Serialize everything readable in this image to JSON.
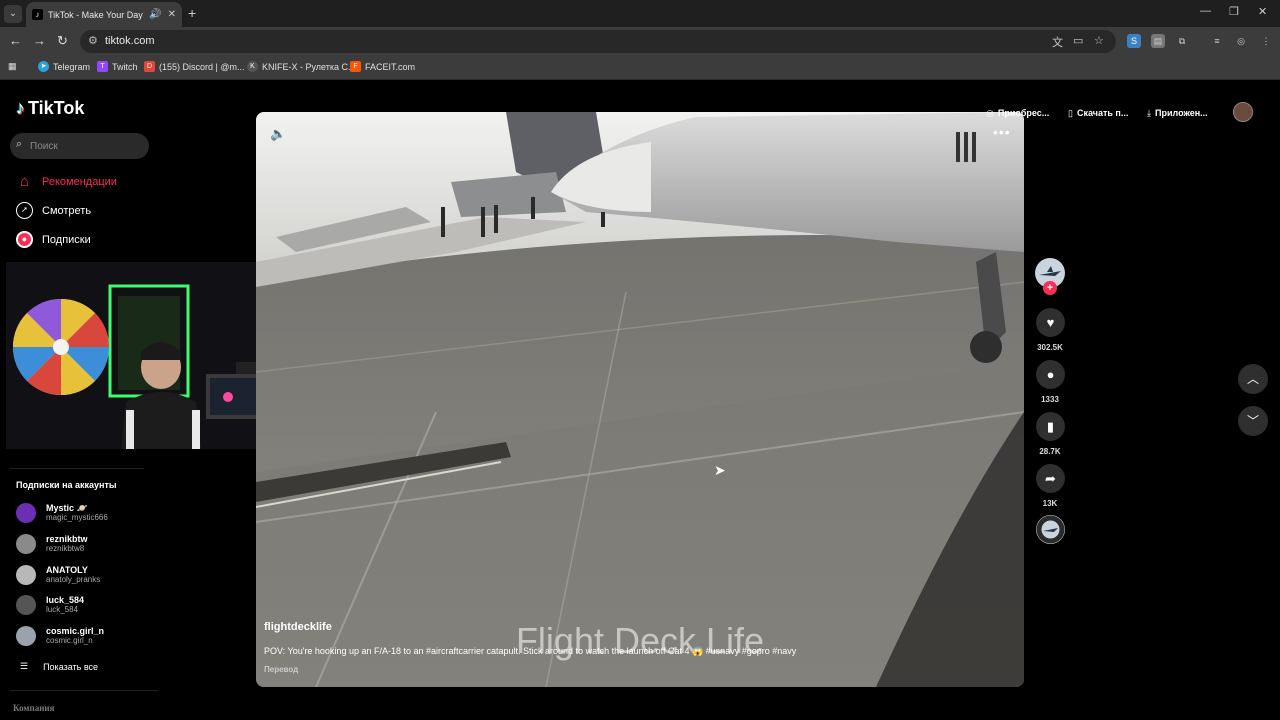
{
  "browser": {
    "tab_title": "TikTok - Make Your Day",
    "tab_favicon": "♪",
    "url": "tiktok.com",
    "bookmarks": [
      {
        "label": "Telegram",
        "color": "#2aa1da",
        "glyph": "➤"
      },
      {
        "label": "Twitch",
        "color": "#9147ff",
        "glyph": "T"
      },
      {
        "label": "(155) Discord | @m...",
        "color": "#e0463c",
        "glyph": "D"
      },
      {
        "label": "KNIFE-X - Рулетка С...",
        "color": "#555555",
        "glyph": "K"
      },
      {
        "label": "FACEIT.com",
        "color": "#ff5500",
        "glyph": "F"
      }
    ]
  },
  "sidebar": {
    "logo": "TikTok",
    "search_placeholder": "Поиск",
    "nav": [
      {
        "label": "Рекомендации",
        "icon": "home-icon"
      },
      {
        "label": "Смотреть",
        "icon": "compass-icon"
      },
      {
        "label": "Подписки",
        "icon": "following-icon"
      }
    ],
    "subs_title": "Подписки на аккаунты",
    "accounts": [
      {
        "name": "Mystic",
        "badge": "🪐",
        "handle": "magic_mystic666",
        "color": "#6b2fb3"
      },
      {
        "name": "reznikbtw",
        "badge": "",
        "handle": "reznikbtw8",
        "color": "#8a8a8a"
      },
      {
        "name": "ANATOLY",
        "badge": "",
        "handle": "anatoly_pranks",
        "color": "#b8b8b8"
      },
      {
        "name": "luck_584",
        "badge": "",
        "handle": "luck_584",
        "color": "#555555"
      },
      {
        "name": "cosmic.girl_n",
        "badge": "",
        "handle": "cosmic.girl_n",
        "color": "#9aa3ad"
      }
    ],
    "show_all": "Показать все",
    "company": "Компания"
  },
  "top_actions": [
    {
      "label": "Приобрес...",
      "icon": "coin-icon"
    },
    {
      "label": "Скачать п...",
      "icon": "phone-icon"
    },
    {
      "label": "Приложен...",
      "icon": "download-icon"
    }
  ],
  "video": {
    "username": "flightdecklife",
    "description": "POV: You're hooking up an F/A-18 to an #aircraftcarrier catapult. Stick around to watch the launch off Cat 4 😱 #usnavy  #gopro #navy",
    "translate": "Перевод",
    "watermark": "Flight Deck Life",
    "likes": "302.5K",
    "comments": "1333",
    "saves": "28.7K",
    "shares": "13K"
  }
}
